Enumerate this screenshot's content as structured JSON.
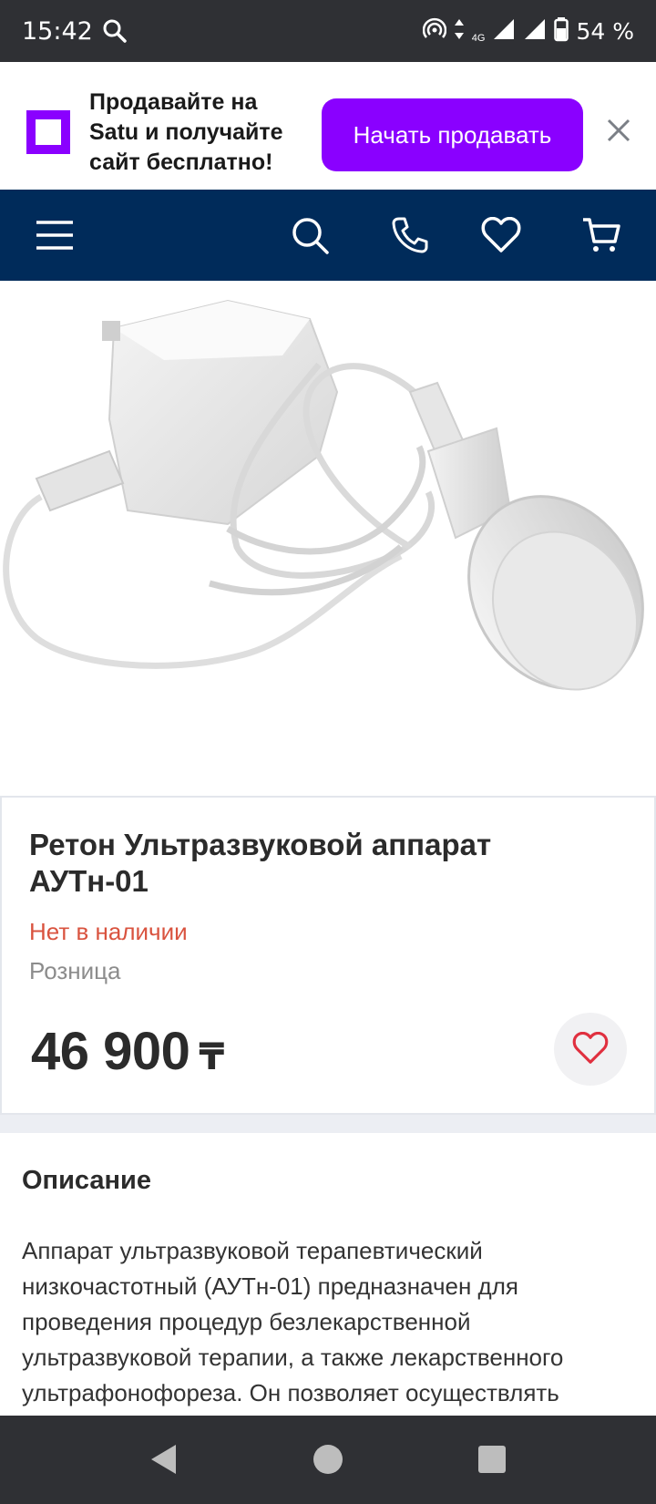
{
  "status_bar": {
    "time": "15:42",
    "network": "4G",
    "battery": "54 %"
  },
  "promo": {
    "text": "Продавайте на Satu и получайте сайт бесплатно!",
    "button_label": "Начать продавать"
  },
  "product": {
    "title": "Ретон Ультразвуковой аппарат АУТн-01",
    "stock_status": "Нет в наличии",
    "price_type": "Розница",
    "price": "46 900",
    "currency": "₸"
  },
  "description": {
    "heading": "Описание",
    "text": "Аппарат ультразвуковой терапевтический низкочастотный (АУТн-01) предназначен для проведения процедур безлекарственной ультразвуковой терапии, а также лекарственного ультрафонофореза. Он позволяет осуществлять"
  },
  "colors": {
    "brand_purple": "#8a00ff",
    "navbar_blue": "#002b5a",
    "out_of_stock_red": "#d9533f",
    "favorite_red": "#e0303f"
  }
}
